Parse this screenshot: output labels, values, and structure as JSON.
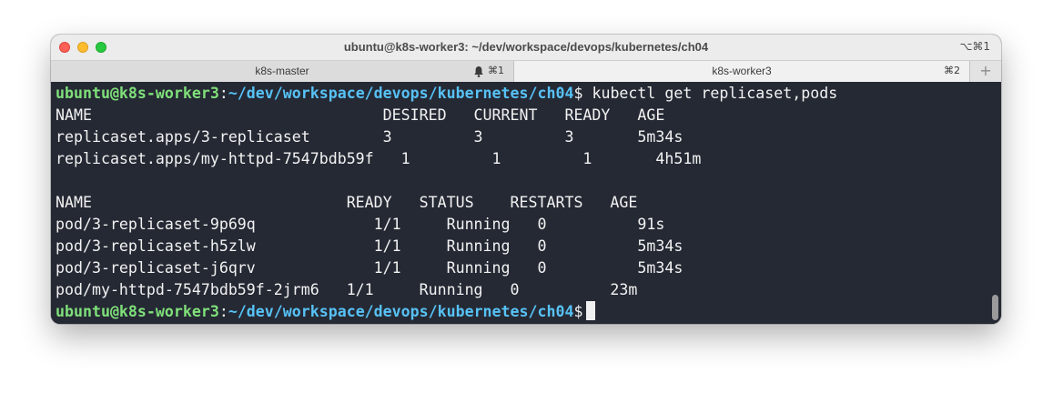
{
  "window": {
    "title": "ubuntu@k8s-worker3: ~/dev/workspace/devops/kubernetes/ch04",
    "shortcut": "⌥⌘1"
  },
  "tabs": [
    {
      "label": "k8s-master",
      "shortcut": "⌘1",
      "icon": "bell-icon"
    },
    {
      "label": "k8s-worker3",
      "shortcut": "⌘2"
    }
  ],
  "new_tab_label": "+",
  "prompt": {
    "user_host": "ubuntu@k8s-worker3",
    "separator": ":",
    "path": "~/dev/workspace/devops/kubernetes/ch04",
    "symbol": "$"
  },
  "command": " kubectl get replicaset,pods",
  "replicaset_table": {
    "header": "NAME                                DESIRED   CURRENT   READY   AGE",
    "rows": [
      "replicaset.apps/3-replicaset        3         3         3       5m34s",
      "replicaset.apps/my-httpd-7547bdb59f   1         1         1       4h51m"
    ]
  },
  "pods_table": {
    "header": "NAME                            READY   STATUS    RESTARTS   AGE",
    "rows": [
      "pod/3-replicaset-9p69q             1/1     Running   0          91s",
      "pod/3-replicaset-h5zlw             1/1     Running   0          5m34s",
      "pod/3-replicaset-j6qrv             1/1     Running   0          5m34s",
      "pod/my-httpd-7547bdb59f-2jrm6   1/1     Running   0          23m"
    ]
  },
  "colors": {
    "terminal_bg": "#252934",
    "user_host": "#7fe07a",
    "path": "#57c2f6",
    "text": "#f2f2f2"
  }
}
